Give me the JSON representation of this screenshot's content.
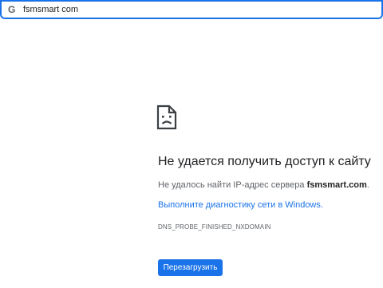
{
  "omnibox": {
    "icon": "google-g-icon",
    "icon_glyph": "G",
    "url": "fsmsmart com"
  },
  "error_page": {
    "icon": "sad-page-icon",
    "title": "Не удается получить доступ к сайту",
    "subtitle_prefix": "Не удалось найти IP-адрес сервера ",
    "subtitle_host": "fsmsmart.com",
    "subtitle_suffix": ".",
    "diagnostics_link": "Выполните диагностику сети в Windows.",
    "error_code": "DNS_PROBE_FINISHED_NXDOMAIN",
    "reload_label": "Перезагрузить"
  },
  "colors": {
    "accent": "#1a73e8",
    "text_primary": "#202124",
    "text_secondary": "#5f6368"
  }
}
